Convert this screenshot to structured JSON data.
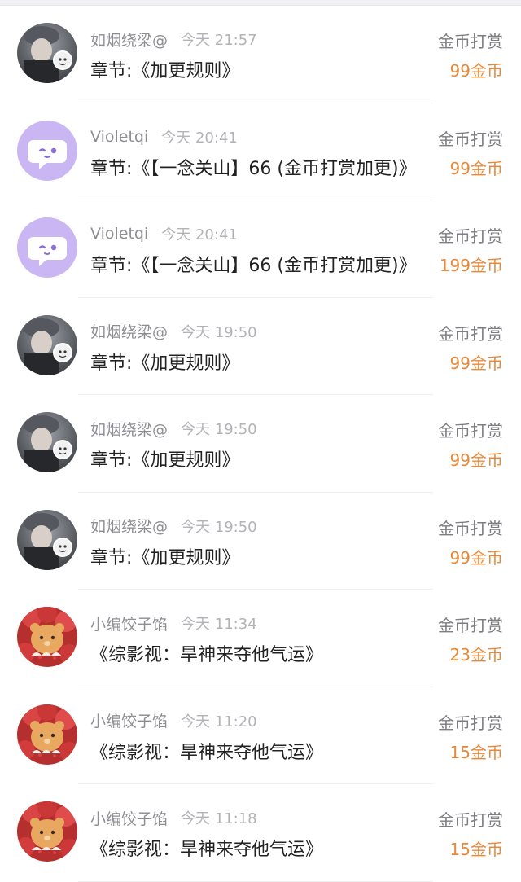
{
  "colors": {
    "amount": "#e8893a",
    "name": "#8e8e93",
    "time": "#b2b2b7",
    "chapter": "#222222",
    "violet_avatar": "#c9b6f2"
  },
  "rewards": [
    {
      "avatar": "girl-photo-avatar",
      "name": "如烟绕梁@",
      "time": "今天 21:57",
      "chapter": "章节:《加更规则》",
      "type": "金币打赏",
      "amount": "99金币"
    },
    {
      "avatar": "violet-chat-avatar",
      "name": "Violetqi",
      "time": "今天 20:41",
      "chapter": "章节:《【一念关山】66 (金币打赏加更)》",
      "type": "金币打赏",
      "amount": "99金币"
    },
    {
      "avatar": "violet-chat-avatar",
      "name": "Violetqi",
      "time": "今天 20:41",
      "chapter": "章节:《【一念关山】66 (金币打赏加更)》",
      "type": "金币打赏",
      "amount": "199金币"
    },
    {
      "avatar": "girl-photo-avatar",
      "name": "如烟绕梁@",
      "time": "今天 19:50",
      "chapter": "章节:《加更规则》",
      "type": "金币打赏",
      "amount": "99金币"
    },
    {
      "avatar": "girl-photo-avatar",
      "name": "如烟绕梁@",
      "time": "今天 19:50",
      "chapter": "章节:《加更规则》",
      "type": "金币打赏",
      "amount": "99金币"
    },
    {
      "avatar": "girl-photo-avatar",
      "name": "如烟绕梁@",
      "time": "今天 19:50",
      "chapter": "章节:《加更规则》",
      "type": "金币打赏",
      "amount": "99金币"
    },
    {
      "avatar": "strawberry-bear-avatar",
      "name": "小编饺子馅",
      "time": "今天 11:34",
      "chapter": "《综影视：旱神来夺他气运》",
      "type": "金币打赏",
      "amount": "23金币"
    },
    {
      "avatar": "strawberry-bear-avatar",
      "name": "小编饺子馅",
      "time": "今天 11:20",
      "chapter": "《综影视：旱神来夺他气运》",
      "type": "金币打赏",
      "amount": "15金币"
    },
    {
      "avatar": "strawberry-bear-avatar",
      "name": "小编饺子馅",
      "time": "今天 11:18",
      "chapter": "《综影视：旱神来夺他气运》",
      "type": "金币打赏",
      "amount": "15金币"
    }
  ]
}
